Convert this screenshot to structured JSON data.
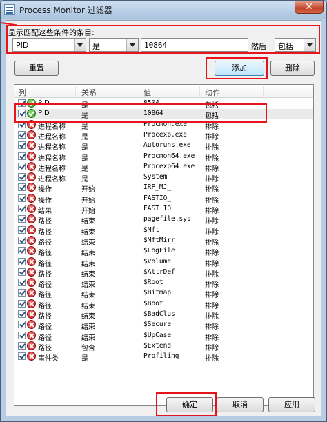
{
  "window": {
    "title": "Process Monitor 过滤器",
    "close": "✕"
  },
  "filter": {
    "prompt": "显示匹配这些条件的条目:",
    "column": "PID",
    "relation": "是",
    "value": "10864",
    "then_label": "然后",
    "action": "包括"
  },
  "buttons": {
    "reset": "重置",
    "add": "添加",
    "remove": "删除",
    "ok": "确定",
    "cancel": "取消",
    "apply": "应用"
  },
  "list": {
    "headers": [
      "列",
      "关系",
      "值",
      "动作"
    ],
    "rows": [
      {
        "status": "ok",
        "column": "PID",
        "relation": "是",
        "value": "8504",
        "action": "包括"
      },
      {
        "status": "ok",
        "column": "PID",
        "relation": "是",
        "value": "10864",
        "action": "包括"
      },
      {
        "status": "no",
        "column": "进程名称",
        "relation": "是",
        "value": "Procmon.exe",
        "action": "排除"
      },
      {
        "status": "no",
        "column": "进程名称",
        "relation": "是",
        "value": "Procexp.exe",
        "action": "排除"
      },
      {
        "status": "no",
        "column": "进程名称",
        "relation": "是",
        "value": "Autoruns.exe",
        "action": "排除"
      },
      {
        "status": "no",
        "column": "进程名称",
        "relation": "是",
        "value": "Procmon64.exe",
        "action": "排除"
      },
      {
        "status": "no",
        "column": "进程名称",
        "relation": "是",
        "value": "Procexp64.exe",
        "action": "排除"
      },
      {
        "status": "no",
        "column": "进程名称",
        "relation": "是",
        "value": "System",
        "action": "排除"
      },
      {
        "status": "no",
        "column": "操作",
        "relation": "开始",
        "value": "IRP_MJ_",
        "action": "排除"
      },
      {
        "status": "no",
        "column": "操作",
        "relation": "开始",
        "value": "FASTIO_",
        "action": "排除"
      },
      {
        "status": "no",
        "column": "结果",
        "relation": "开始",
        "value": "FAST IO",
        "action": "排除"
      },
      {
        "status": "no",
        "column": "路径",
        "relation": "结束",
        "value": "pagefile.sys",
        "action": "排除"
      },
      {
        "status": "no",
        "column": "路径",
        "relation": "结束",
        "value": "$Mft",
        "action": "排除"
      },
      {
        "status": "no",
        "column": "路径",
        "relation": "结束",
        "value": "$MftMirr",
        "action": "排除"
      },
      {
        "status": "no",
        "column": "路径",
        "relation": "结束",
        "value": "$LogFile",
        "action": "排除"
      },
      {
        "status": "no",
        "column": "路径",
        "relation": "结束",
        "value": "$Volume",
        "action": "排除"
      },
      {
        "status": "no",
        "column": "路径",
        "relation": "结束",
        "value": "$AttrDef",
        "action": "排除"
      },
      {
        "status": "no",
        "column": "路径",
        "relation": "结束",
        "value": "$Root",
        "action": "排除"
      },
      {
        "status": "no",
        "column": "路径",
        "relation": "结束",
        "value": "$Bitmap",
        "action": "排除"
      },
      {
        "status": "no",
        "column": "路径",
        "relation": "结束",
        "value": "$Boot",
        "action": "排除"
      },
      {
        "status": "no",
        "column": "路径",
        "relation": "结束",
        "value": "$BadClus",
        "action": "排除"
      },
      {
        "status": "no",
        "column": "路径",
        "relation": "结束",
        "value": "$Secure",
        "action": "排除"
      },
      {
        "status": "no",
        "column": "路径",
        "relation": "结束",
        "value": "$UpCase",
        "action": "排除"
      },
      {
        "status": "no",
        "column": "路径",
        "relation": "包含",
        "value": "$Extend",
        "action": "排除"
      },
      {
        "status": "no",
        "column": "事件类",
        "relation": "是",
        "value": "Profiling",
        "action": "排除"
      }
    ]
  },
  "colors": {
    "highlight": "#e8141c",
    "include_icon": "#2f9a22",
    "exclude_icon": "#c31515"
  }
}
